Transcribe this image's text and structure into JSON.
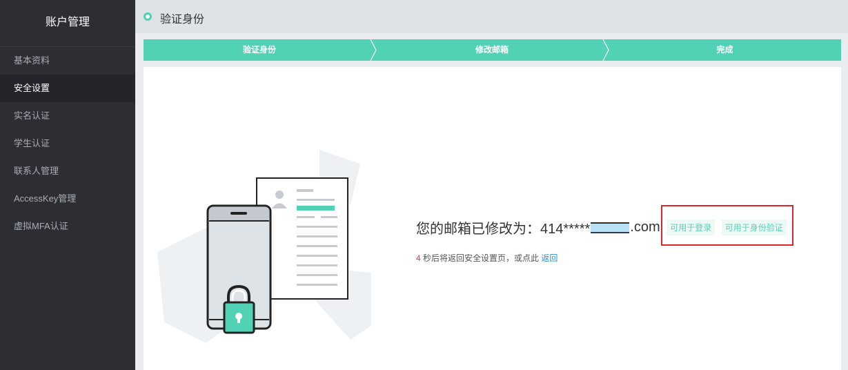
{
  "sidebar": {
    "title": "账户管理",
    "items": [
      {
        "label": "基本资料"
      },
      {
        "label": "安全设置"
      },
      {
        "label": "实名认证"
      },
      {
        "label": "学生认证"
      },
      {
        "label": "联系人管理"
      },
      {
        "label": "AccessKey管理"
      },
      {
        "label": "虚拟MFA认证"
      }
    ],
    "active_item": "安全设置"
  },
  "header": {
    "title": "验证身份"
  },
  "steps": [
    {
      "label": "验证身份"
    },
    {
      "label": "修改邮箱"
    },
    {
      "label": "完成"
    }
  ],
  "result": {
    "message_prefix": "您的邮箱已修改为：414*****",
    "message_suffix": ".com",
    "tags": [
      "可用于登录",
      "可用于身份验证"
    ]
  },
  "countdown": {
    "seconds": "4",
    "text": " 秒后将返回安全设置页，或点此 ",
    "link_label": "返回"
  },
  "colors": {
    "accent": "#52d2b5",
    "sidebar_bg": "#2c2e34",
    "highlight": "#d9262b",
    "link": "#2a8fd6"
  }
}
